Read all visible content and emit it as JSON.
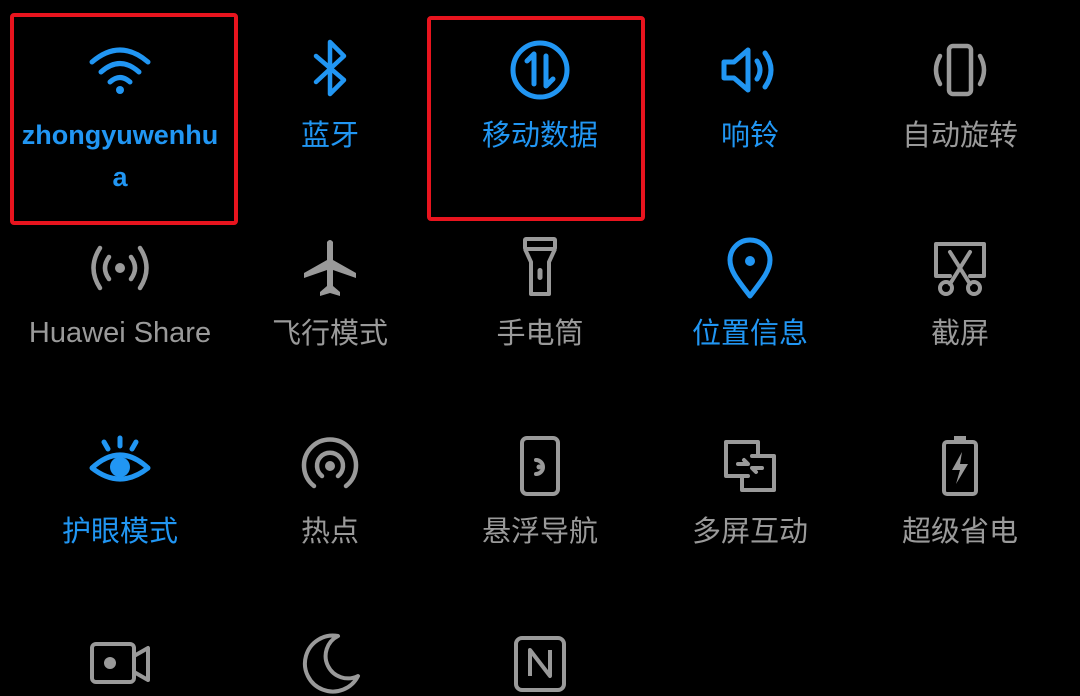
{
  "tiles": [
    {
      "label": "zhongyuwenhu\na",
      "active": true,
      "icon": "wifi-icon"
    },
    {
      "label": "蓝牙",
      "active": true,
      "icon": "bluetooth-icon"
    },
    {
      "label": "移动数据",
      "active": true,
      "icon": "mobile-data-icon"
    },
    {
      "label": "响铃",
      "active": true,
      "icon": "ring-volume-icon"
    },
    {
      "label": "自动旋转",
      "active": false,
      "icon": "auto-rotate-icon"
    },
    {
      "label": "Huawei Share",
      "active": false,
      "icon": "huawei-share-icon"
    },
    {
      "label": "飞行模式",
      "active": false,
      "icon": "airplane-icon"
    },
    {
      "label": "手电筒",
      "active": false,
      "icon": "flashlight-icon"
    },
    {
      "label": "位置信息",
      "active": true,
      "icon": "location-icon"
    },
    {
      "label": "截屏",
      "active": false,
      "icon": "screenshot-icon"
    },
    {
      "label": "护眼模式",
      "active": true,
      "icon": "eye-icon"
    },
    {
      "label": "热点",
      "active": false,
      "icon": "hotspot-icon"
    },
    {
      "label": "悬浮导航",
      "active": false,
      "icon": "floating-navigation-icon"
    },
    {
      "label": "多屏互动",
      "active": false,
      "icon": "multi-screen-icon"
    },
    {
      "label": "超级省电",
      "active": false,
      "icon": "battery-saver-icon"
    },
    {
      "label": "",
      "active": false,
      "icon": "screen-recorder-icon"
    },
    {
      "label": "",
      "active": false,
      "icon": "moon-icon"
    },
    {
      "label": "",
      "active": false,
      "icon": "nfc-icon"
    }
  ],
  "colors": {
    "active": "#2196f3",
    "inactive": "#9a9a9a",
    "highlight": "#e8141e",
    "background": "#000000"
  }
}
